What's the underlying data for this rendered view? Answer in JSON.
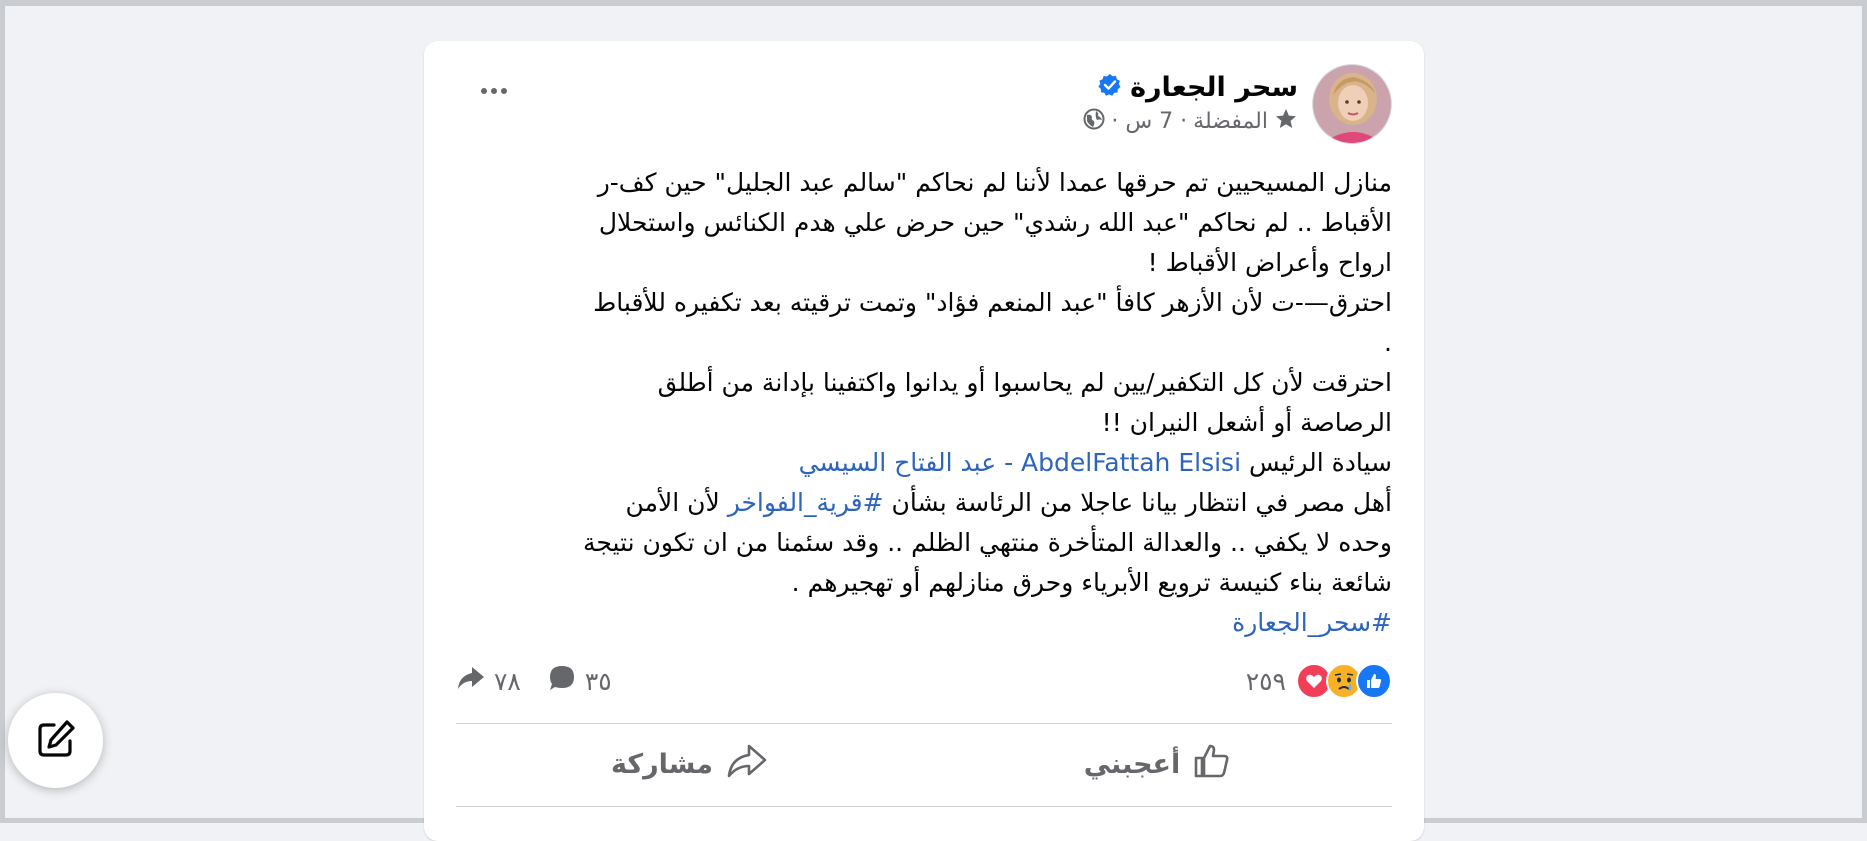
{
  "post": {
    "author": "سحر الجعارة",
    "audience": "المفضلة",
    "time": "· 7 س ·",
    "body_lines": [
      "منازل المسيحيين تم حرقها عمدا لأننا لم نحاكم \"سالم عبد الجليل\" حين كف-ر",
      "الأقباط .. لم نحاكم \"عبد الله رشدي\" حين حرض علي هدم الكنائس واستحلال",
      "ارواح وأعراض الأقباط !",
      "احترق—-ت  لأن الأزهر كافأ \"عبد المنعم فؤاد\" وتمت ترقيته بعد تكفيره للأقباط",
      ".",
      "احترقت  لأن كل التكفير/يين  لم يحاسبوا أو يدانوا واكتفينا بإدانة من أطلق",
      "الرصاصة أو أشعل النيران !!"
    ],
    "president_prefix": "سيادة الرئيس ",
    "president_link": "AbdelFattah Elsisi - عبد الفتاح السيسي",
    "line8_before": "أهل مصر في انتظار بيانا عاجلا من الرئاسة بشأن ",
    "line8_hashtag": "#قرية_الفواخر",
    "line8_after": " لأن الأمن",
    "line9": "وحده لا يكفي .. والعدالة المتأخرة منتهي الظلم .. وقد سئمنا من ان تكون نتيجة",
    "line10": "شائعة بناء كنيسة ترويع الأبرياء وحرق منازلهم أو تهجيرهم .",
    "author_hashtag": "#سحر_الجعارة"
  },
  "stats": {
    "reactions_count": "٢٥٩",
    "comments_count": "٣٥",
    "shares_count": "٧٨"
  },
  "actions": {
    "like_label": "أعجبني",
    "share_label": "مشاركة"
  },
  "colors": {
    "link": "#2d64bc",
    "verified": "#1877f2",
    "like_blue": "#1877f2",
    "love_red": "#f33e58",
    "sad_yellow": "#f7b125"
  },
  "icons": [
    "more-options-icon",
    "verified-badge-icon",
    "star-icon",
    "globe-icon",
    "like-reaction-icon",
    "sad-reaction-icon",
    "love-reaction-icon",
    "comment-icon",
    "share-icon",
    "like-thumb-icon",
    "compose-icon"
  ]
}
